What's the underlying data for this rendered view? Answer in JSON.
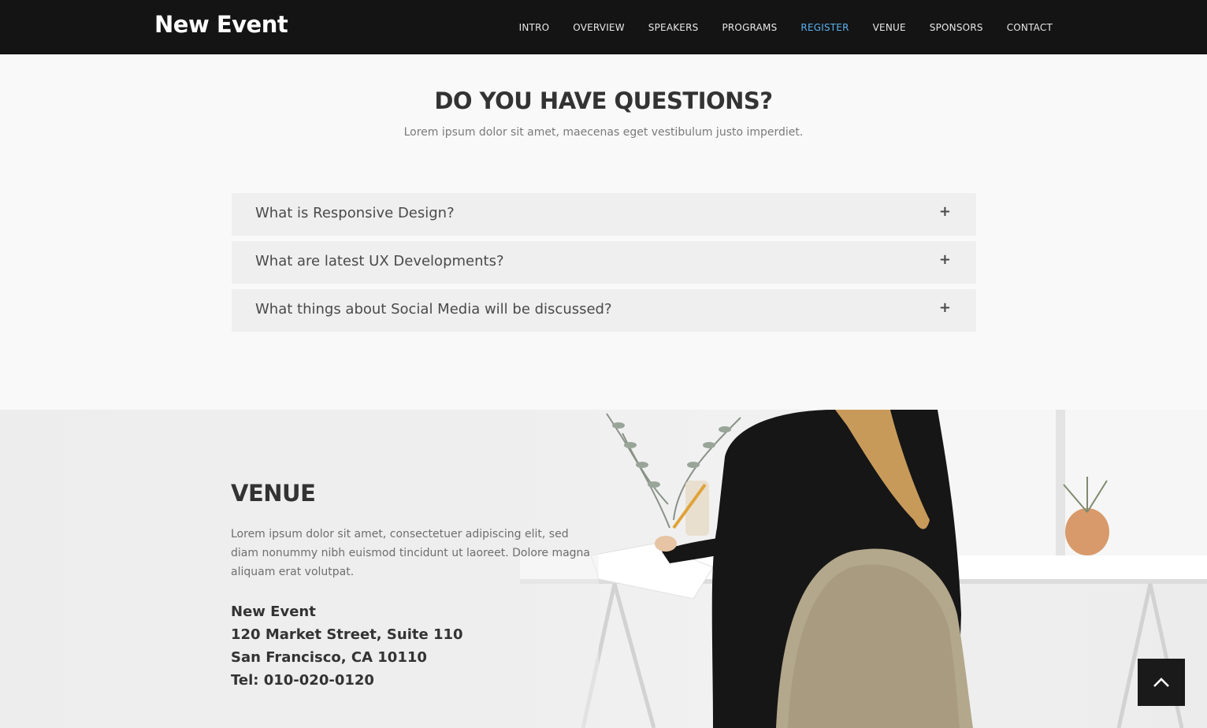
{
  "header": {
    "brand": "New Event",
    "nav": [
      {
        "label": "INTRO",
        "active": false
      },
      {
        "label": "OVERVIEW",
        "active": false
      },
      {
        "label": "SPEAKERS",
        "active": false
      },
      {
        "label": "PROGRAMS",
        "active": false
      },
      {
        "label": "REGISTER",
        "active": true
      },
      {
        "label": "VENUE",
        "active": false
      },
      {
        "label": "SPONSORS",
        "active": false
      },
      {
        "label": "CONTACT",
        "active": false
      }
    ]
  },
  "faq": {
    "title": "DO YOU HAVE QUESTIONS?",
    "subtitle": "Lorem ipsum dolor sit amet, maecenas eget vestibulum justo imperdiet.",
    "items": [
      {
        "question": "What is Responsive Design?",
        "toggle": "+"
      },
      {
        "question": "What are latest UX Developments?",
        "toggle": "+"
      },
      {
        "question": "What things about Social Media will be discussed?",
        "toggle": "+"
      }
    ]
  },
  "venue": {
    "title": "VENUE",
    "description": "Lorem ipsum dolor sit amet, consectetuer adipiscing elit, sed diam nonummy nibh euismod tincidunt ut laoreet. Dolore magna aliquam erat volutpat.",
    "address": {
      "line1": "New Event",
      "line2": "120 Market Street, Suite 110",
      "line3": "San Francisco, CA 10110",
      "line4": "Tel: 010-020-0120"
    }
  },
  "colors": {
    "header_bg": "#141414",
    "nav_active": "#5ab1ef",
    "accordion_bg": "#efefef"
  },
  "icons": {
    "back_to_top": "chevron-up-icon"
  }
}
